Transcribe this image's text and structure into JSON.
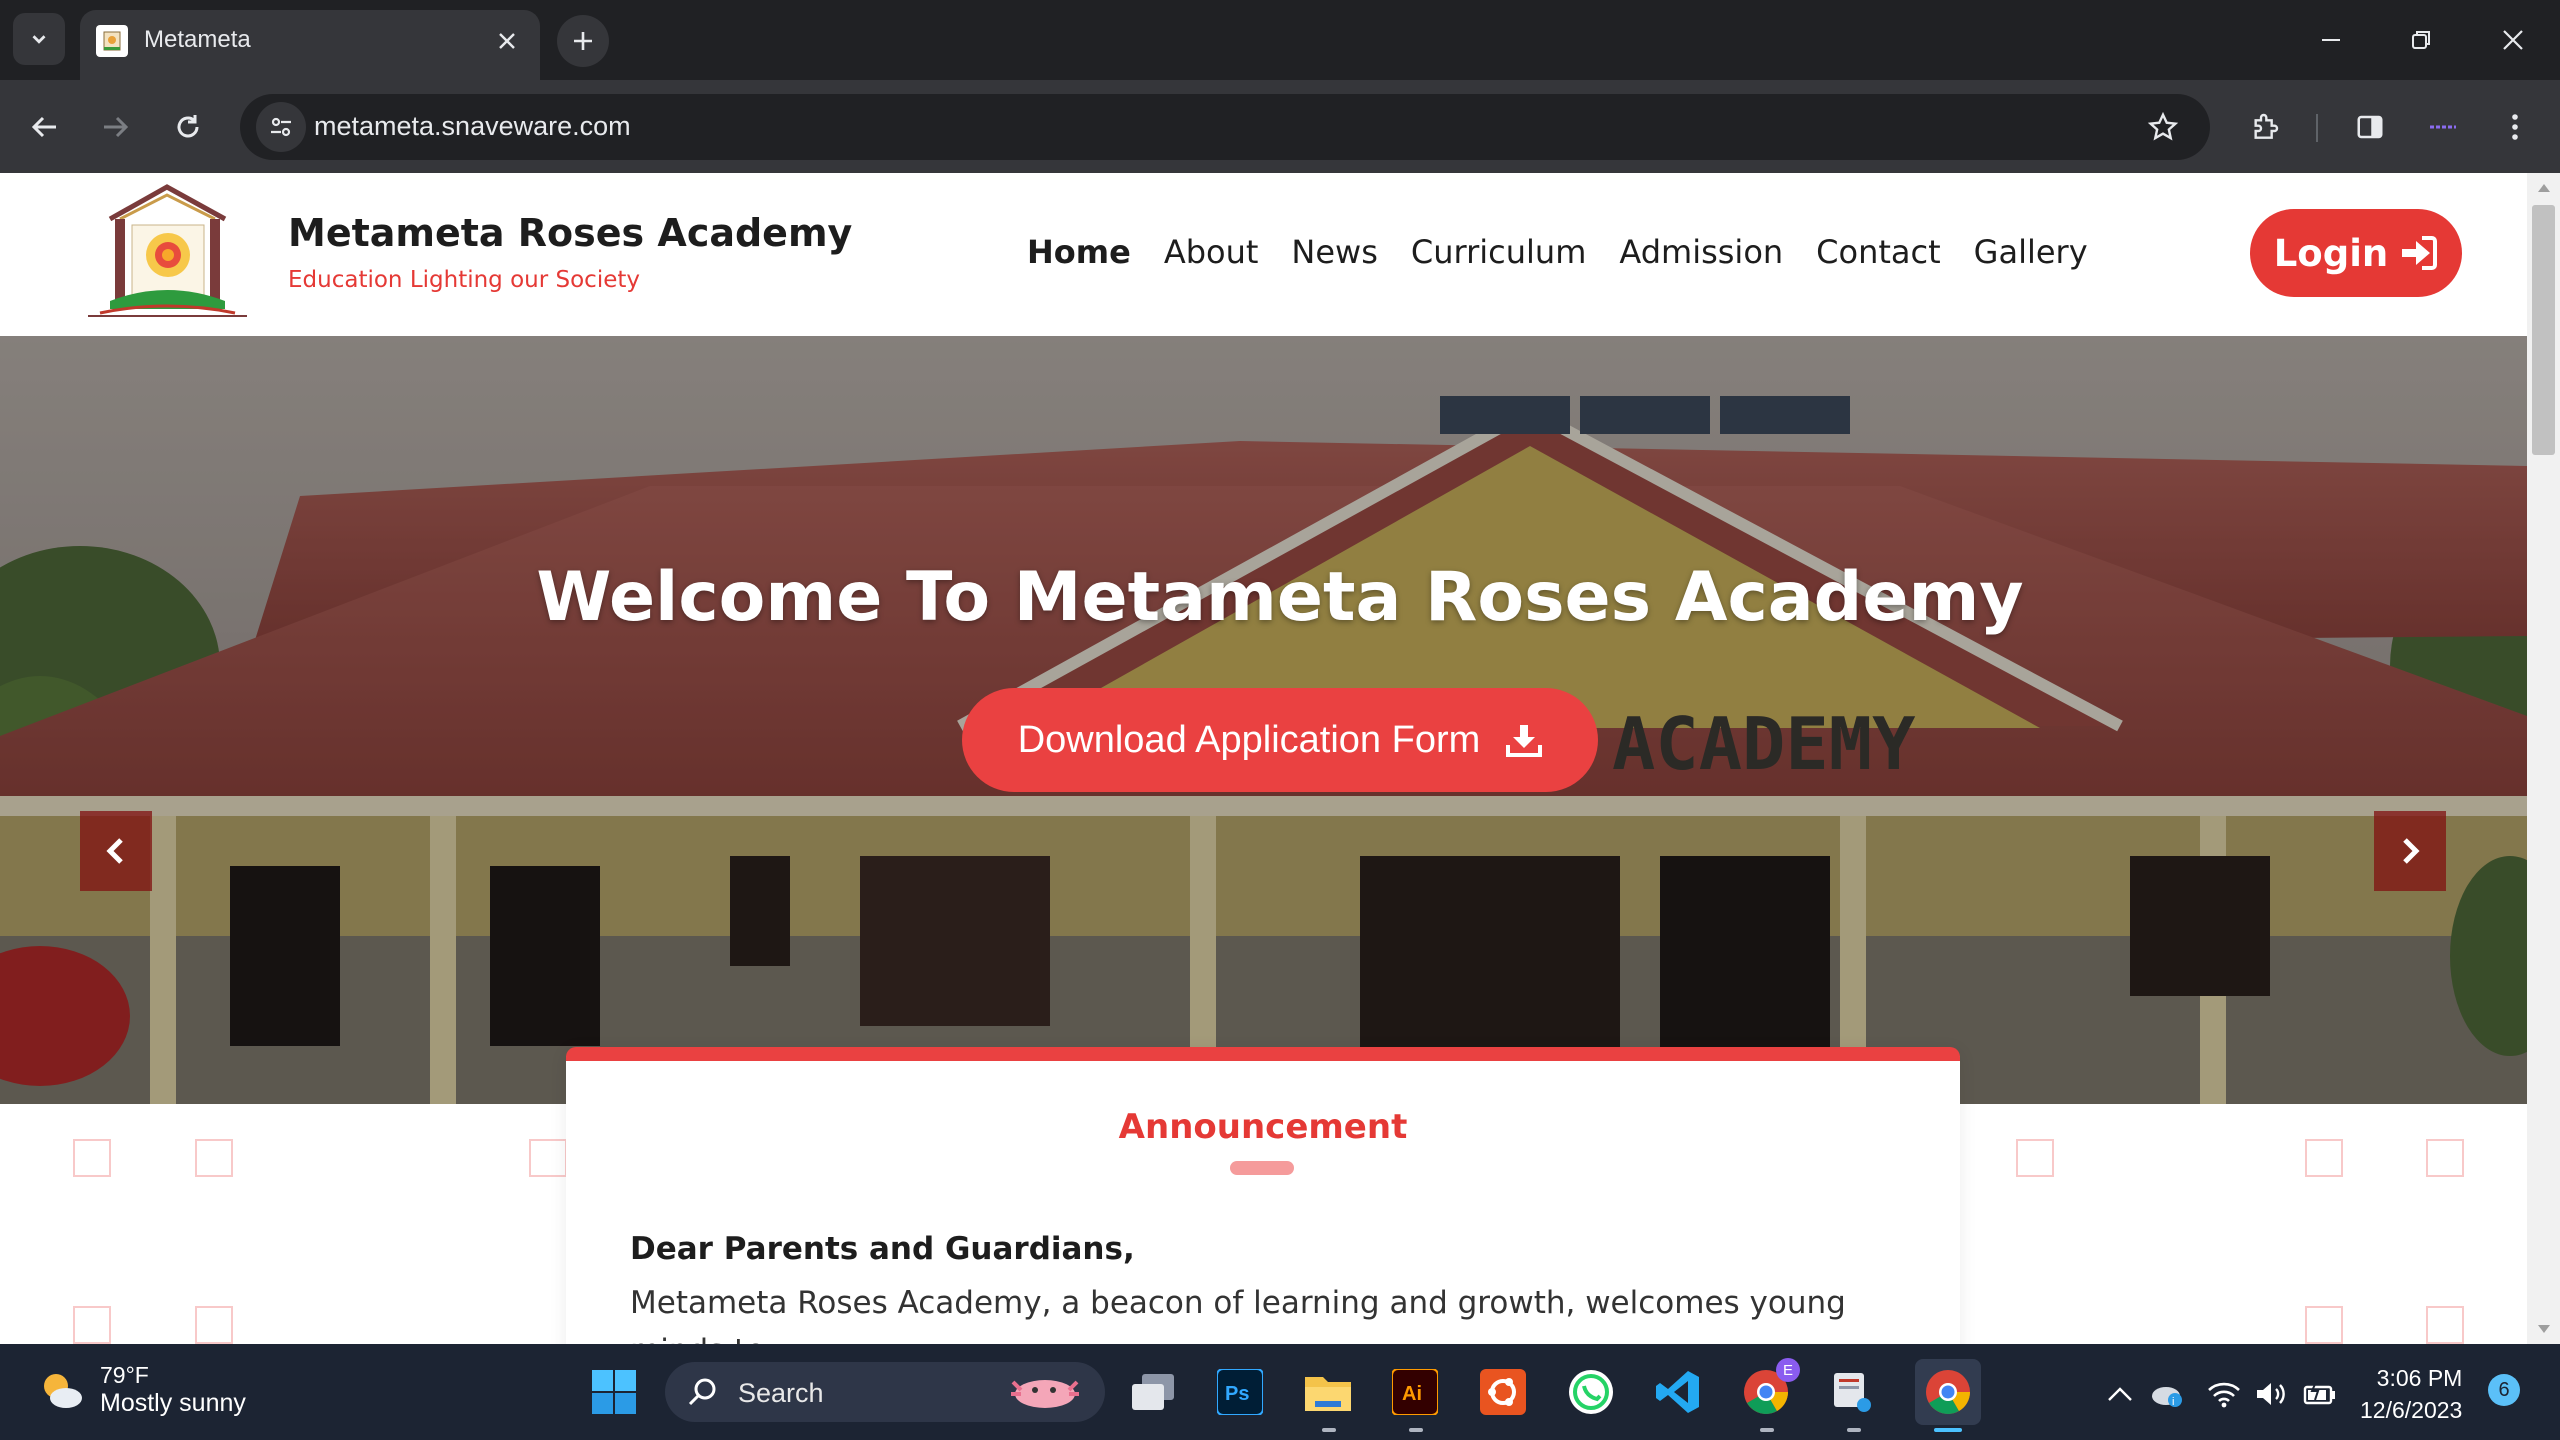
{
  "browser": {
    "tab_title": "Metameta",
    "url": "metameta.snaveware.com"
  },
  "site": {
    "brand_name": "Metameta Roses Academy",
    "tagline": "Education Lighting our Society",
    "nav": [
      {
        "label": "Home",
        "active": true
      },
      {
        "label": "About"
      },
      {
        "label": "News"
      },
      {
        "label": "Curriculum"
      },
      {
        "label": "Admission"
      },
      {
        "label": "Contact"
      },
      {
        "label": "Gallery"
      }
    ],
    "login_label": "Login",
    "colors": {
      "accent": "#e53935",
      "button": "#ea4141"
    }
  },
  "hero": {
    "title": "Welcome To Metameta Roses Academy",
    "download_label": "Download Application Form",
    "building_sign": "ACADEMY"
  },
  "announcement": {
    "title": "Announcement",
    "greeting": "Dear Parents and Guardians,",
    "body": "Metameta Roses Academy, a beacon of learning and growth, welcomes young minds to"
  },
  "taskbar": {
    "weather_temp": "79°F",
    "weather_condition": "Mostly sunny",
    "search_label": "Search",
    "time": "3:06 PM",
    "date": "12/6/2023",
    "notification_count": "6",
    "chrome_profile_badge": "E"
  }
}
